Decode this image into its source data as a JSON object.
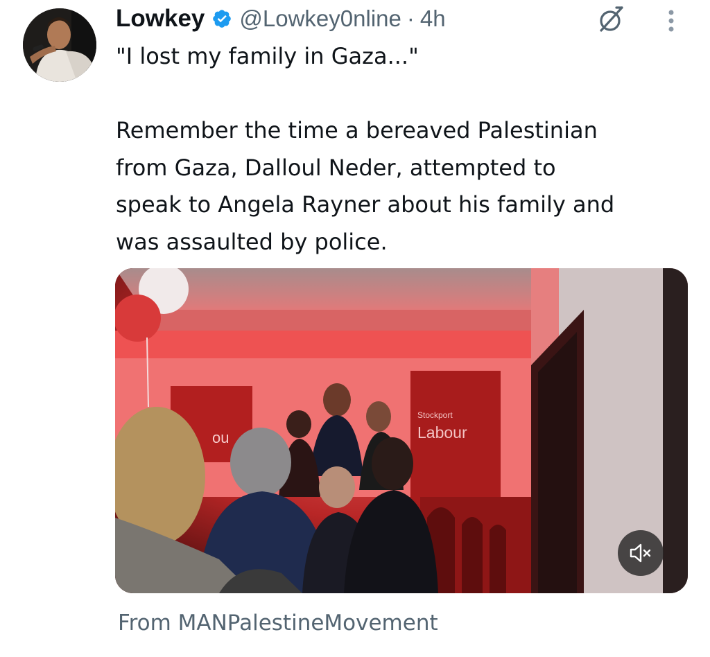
{
  "tweet": {
    "author": {
      "display_name": "Lowkey",
      "handle": "@Lowkey0nline",
      "verified": true
    },
    "separator": "·",
    "time": "4h",
    "text": {
      "line1": "\"I lost my family in Gaza...\"",
      "paragraph2": [
        "Remember the time a bereaved Palestinian",
        "from Gaza, Dalloul Neder, attempted to",
        "speak to Angela Rayner about his family and",
        "was assaulted by police."
      ]
    },
    "media": {
      "type": "video",
      "muted": true,
      "sign_text_small": "Stockport",
      "sign_text_large": "Labour",
      "left_sign_fragment": "ou"
    },
    "attribution": "From MANPalestineMovement"
  },
  "icons": {
    "verified": "verified-badge-icon",
    "grok": "grok-icon",
    "more": "more-vertical-icon",
    "mute": "speaker-muted-icon"
  },
  "colors": {
    "verified_blue": "#1d9bf0",
    "secondary_text": "#536471",
    "primary_text": "#0f1419"
  }
}
